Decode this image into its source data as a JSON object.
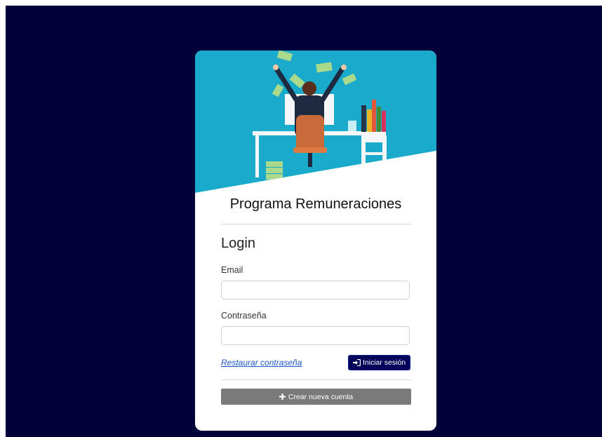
{
  "colors": {
    "page_background": "#02023a",
    "hero_background": "#1aaacb",
    "primary_button": "#04055a",
    "secondary_button": "#7a7a7a",
    "link": "#1a56c8"
  },
  "card": {
    "hero_image_icon": "man-celebrating-at-desk-illustration",
    "title": "Programa Remuneraciones"
  },
  "login": {
    "heading": "Login",
    "email_label": "Email",
    "email_value": "",
    "password_label": "Contraseña",
    "password_value": "",
    "restore_link": "Restaurar contraseña",
    "submit_icon": "sign-in-icon",
    "submit_label": "Iniciar sesión",
    "create_icon": "plus-icon",
    "create_label": "Crear nueva cuenta"
  }
}
